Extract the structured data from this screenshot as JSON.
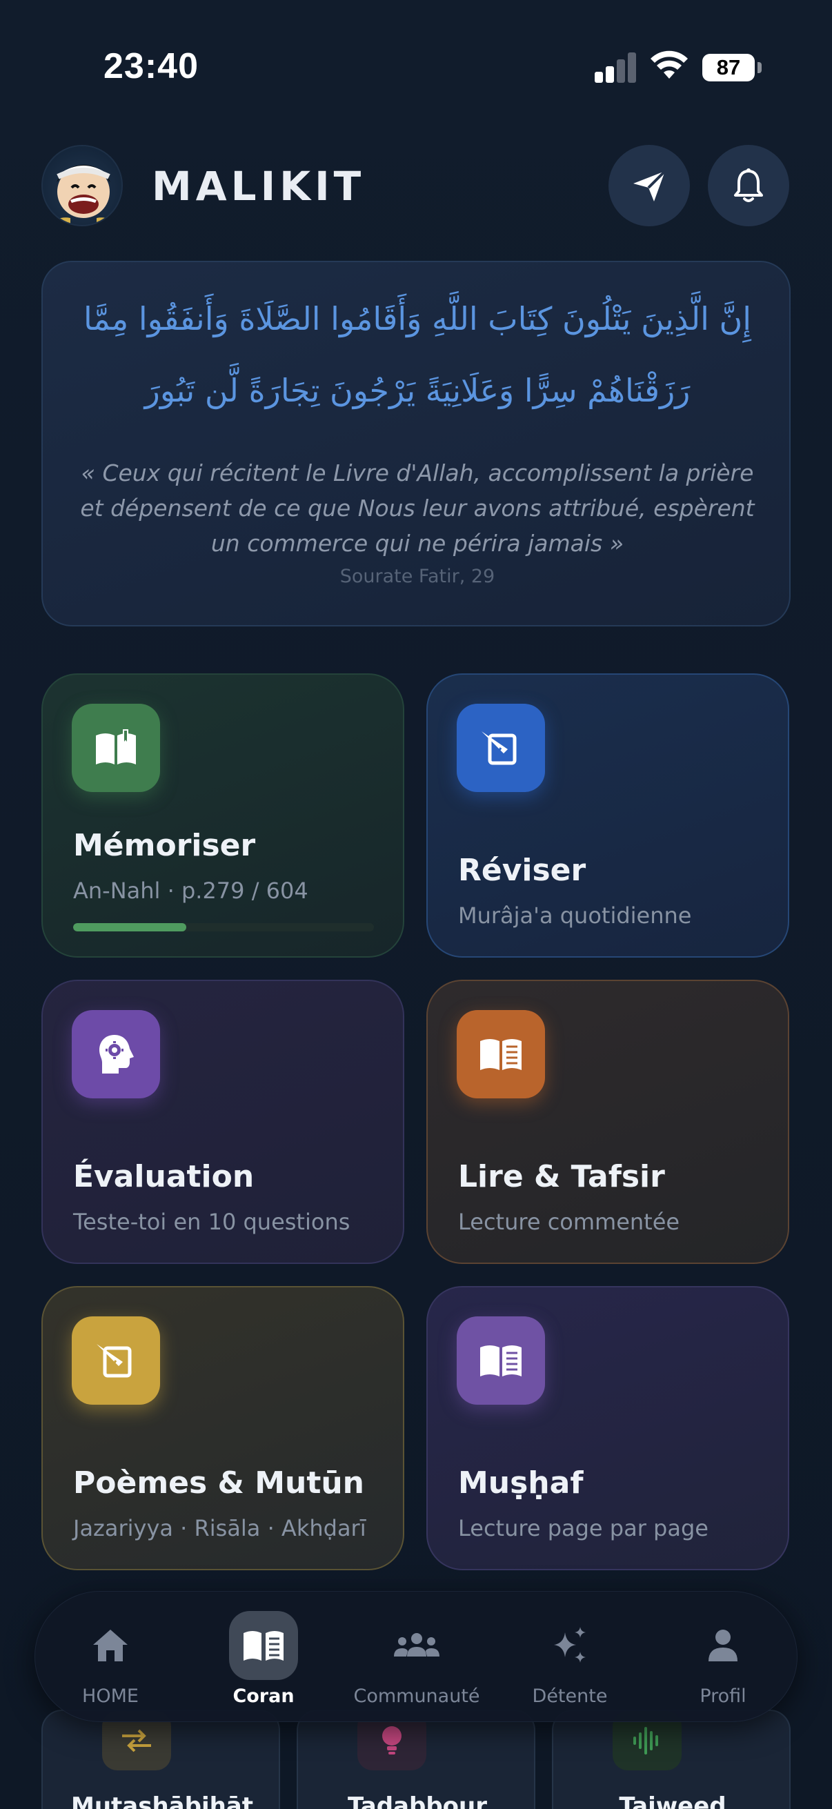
{
  "status_bar": {
    "time": "23:40",
    "battery": "87",
    "icons": [
      "signal-icon",
      "wifi-icon",
      "battery-icon"
    ]
  },
  "header": {
    "app_title": "MALIKIT",
    "avatar": "avatar",
    "actions": [
      "send-icon",
      "bell-icon"
    ]
  },
  "verse": {
    "arabic_line1": "إِنَّ الَّذِينَ يَتْلُونَ كِتَابَ اللَّهِ وَأَقَامُوا الصَّلَاةَ وَأَنفَقُوا مِمَّا",
    "arabic_line2": "رَزَقْنَاهُمْ سِرًّا وَعَلَانِيَةً يَرْجُونَ تِجَارَةً لَّن تَبُورَ",
    "translation": "« Ceux qui récitent le Livre d'Allah, accomplissent la prière et dépensent de ce que Nous leur avons attribué, espèrent un commerce qui ne périra jamais »",
    "source": "Sourate Fatir, 29"
  },
  "cards": {
    "memoriser": {
      "title": "Mémoriser",
      "subtitle": "An-Nahl · p.279 / 604",
      "progress": 0.376,
      "icon": "open-book-icon",
      "color": "#3f7d4e"
    },
    "reviser": {
      "title": "Réviser",
      "subtitle": "Murâja'a quotidienne",
      "icon": "quill-icon",
      "color": "#2c63c4"
    },
    "evaluation": {
      "title": "Évaluation",
      "subtitle": "Teste-toi en 10 questions",
      "icon": "brain-gear-icon",
      "color": "#6d4ba8"
    },
    "lire": {
      "title": "Lire & Tafsir",
      "subtitle": "Lecture commentée",
      "icon": "reading-book-icon",
      "color": "#b9642c"
    },
    "poemes": {
      "title": "Poèmes & Mutūn",
      "subtitle": "Jazariyya · Risāla · Akhḍarī",
      "icon": "quill-icon",
      "color": "#c9a33e"
    },
    "mushaf": {
      "title": "Muṣḥaf",
      "subtitle": "Lecture page par page",
      "icon": "reading-book-icon",
      "color": "#6f52a4"
    }
  },
  "more_cards": [
    {
      "title": "Mutashābihāt",
      "icon": "swap-arrows-icon",
      "color": "#c9a33e"
    },
    {
      "title": "Tadabbour",
      "icon": "lightbulb-icon",
      "color": "#c2467e"
    },
    {
      "title": "Tajweed",
      "icon": "soundwave-icon",
      "color": "#3f9b55"
    }
  ],
  "bottom_nav": [
    {
      "label": "HOME",
      "icon": "home-icon",
      "active": false
    },
    {
      "label": "Coran",
      "icon": "quran-book-icon",
      "active": true
    },
    {
      "label": "Communauté",
      "icon": "community-icon",
      "active": false
    },
    {
      "label": "Détente",
      "icon": "sparkles-icon",
      "active": false
    },
    {
      "label": "Profil",
      "icon": "user-icon",
      "active": false
    }
  ]
}
